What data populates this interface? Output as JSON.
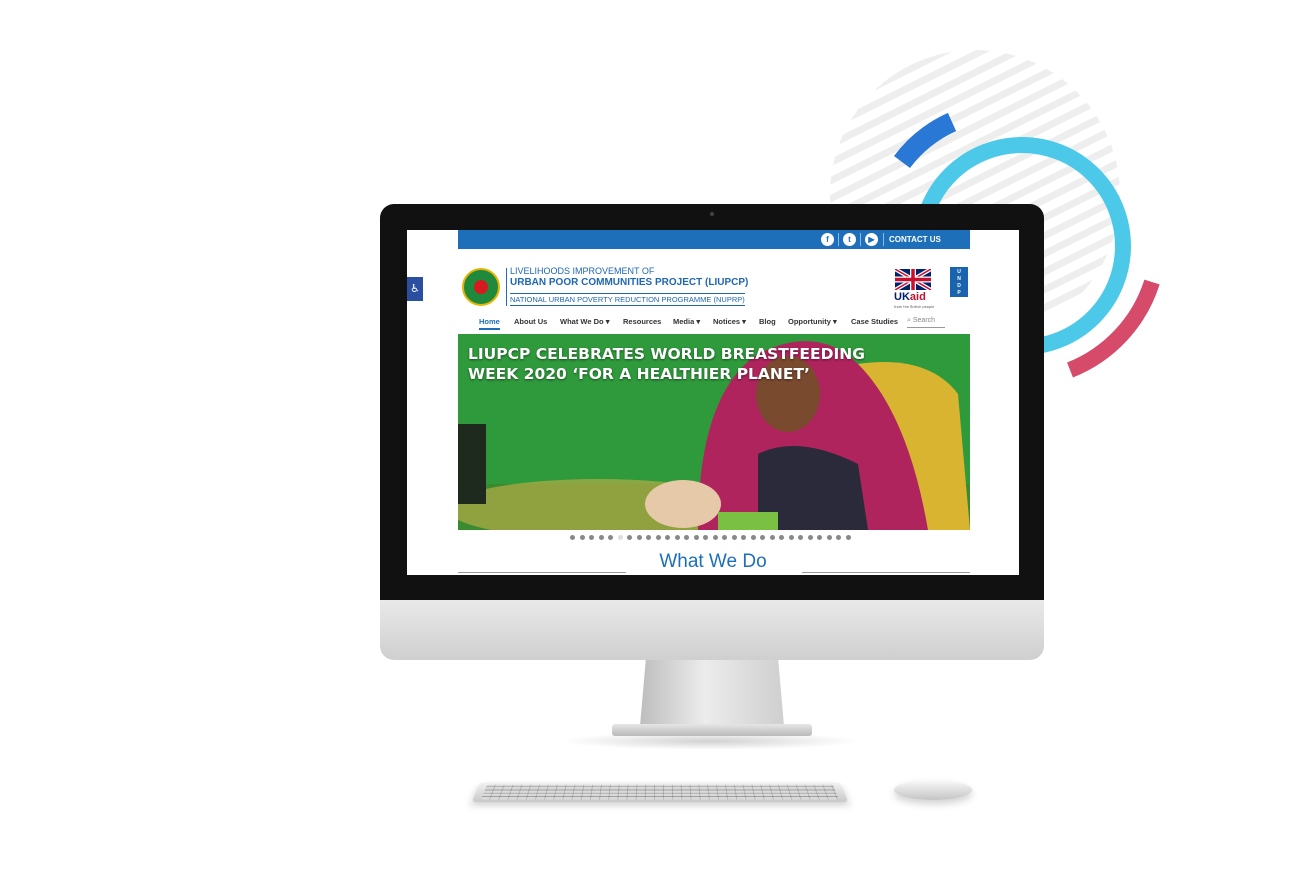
{
  "colors": {
    "brand_blue": "#1e6fba",
    "deco_cyan": "#4cc9e8",
    "deco_blue": "#2a78d6",
    "deco_pink": "#d64a6a",
    "hero_green": "#2f9a3c",
    "hero_magenta": "#b0245e"
  },
  "topbar": {
    "social_icons": [
      "facebook-icon",
      "twitter-icon",
      "youtube-icon"
    ],
    "contact_label": "CONTACT US"
  },
  "header": {
    "line1": "LIVELIHOODS IMPROVEMENT OF",
    "line2": "URBAN POOR COMMUNITIES PROJECT (LIUPCP)",
    "line3": "NATIONAL URBAN POVERTY REDUCTION PROGRAMME (NUPRP)",
    "ukaid_uk": "UK",
    "ukaid_aid": "aid",
    "ukaid_tag": "from the British people",
    "undp": [
      "U",
      "N",
      "D",
      "P"
    ]
  },
  "nav": {
    "items": [
      {
        "label": "Home"
      },
      {
        "label": "About Us"
      },
      {
        "label": "What We Do ▾"
      },
      {
        "label": "Resources"
      },
      {
        "label": "Media ▾"
      },
      {
        "label": "Notices ▾"
      },
      {
        "label": "Blog"
      },
      {
        "label": "Opportunity ▾"
      },
      {
        "label": "Case Studies"
      }
    ],
    "search_placeholder": "Search"
  },
  "hero": {
    "title_line1": "LIUPCP CELEBRATES WORLD BREASTFEEDING",
    "title_line2": "WEEK 2020 ‘FOR A HEALTHIER PLANET’"
  },
  "carousel": {
    "total": 30,
    "active_index": 5
  },
  "section": {
    "title": "What We Do"
  }
}
